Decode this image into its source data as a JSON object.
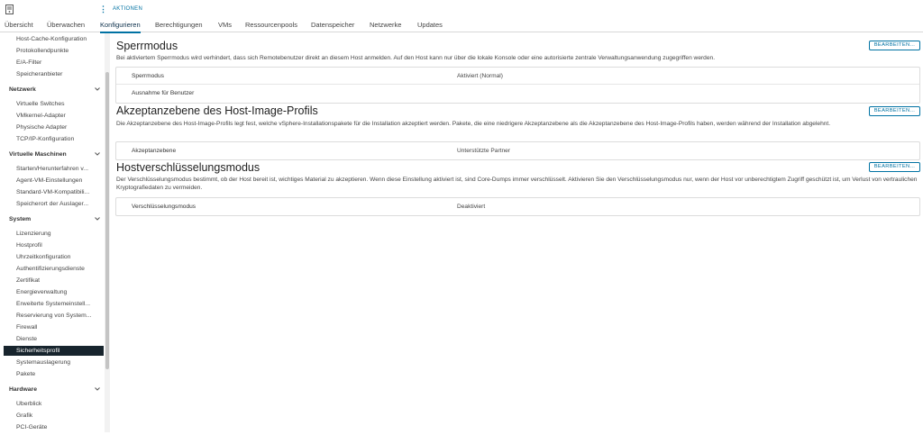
{
  "topbar": {
    "actions_label": "AKTIONEN",
    "host_icon": "host-server-icon",
    "actions_icon": "vertical-dots-icon"
  },
  "tabs": [
    {
      "label": "Übersicht"
    },
    {
      "label": "Überwachen"
    },
    {
      "label": "Konfigurieren",
      "active": true
    },
    {
      "label": "Berechtigungen"
    },
    {
      "label": "VMs"
    },
    {
      "label": "Ressourcenpools"
    },
    {
      "label": "Datenspeicher"
    },
    {
      "label": "Netzwerke"
    },
    {
      "label": "Updates"
    }
  ],
  "sidebar": {
    "top_items": [
      "Host-Cache-Konfiguration",
      "Protokollendpunkte",
      "E/A-Filter",
      "Speicheranbieter"
    ],
    "network": {
      "title": "Netzwerk",
      "items": [
        "Virtuelle Switches",
        "VMkernel-Adapter",
        "Physische Adapter",
        "TCP/IP-Konfiguration"
      ]
    },
    "vms": {
      "title": "Virtuelle Maschinen",
      "items": [
        "Starten/Herunterfahren v...",
        "Agent-VM-Einstellungen",
        "Standard-VM-Kompatibili...",
        "Speicherort der Auslager..."
      ]
    },
    "system": {
      "title": "System",
      "items": [
        "Lizenzierung",
        "Hostprofil",
        "Uhrzeitkonfiguration",
        "Authentifizierungsdienste",
        "Zertifikat",
        "Energieverwaltung",
        "Erweiterte Systemeinstell...",
        "Reservierung von System...",
        "Firewall",
        "Dienste",
        "Sicherheitsprofil",
        "Systemauslagerung",
        "Pakete"
      ],
      "selected": "Sicherheitsprofil"
    },
    "hardware": {
      "title": "Hardware",
      "items": [
        "Überblick",
        "Grafik",
        "PCI-Geräte"
      ]
    },
    "chevron_icon": "chevron-down-icon"
  },
  "sections": {
    "lockdown": {
      "title": "Sperrmodus",
      "description": "Bei aktiviertem Sperrmodus wird verhindert, dass sich Remotebenutzer direkt an diesem Host anmelden. Auf den Host kann nur über die lokale Konsole oder eine autorisierte zentrale Verwaltungsanwendung zugegriffen werden.",
      "edit_label": "BEARBEITEN...",
      "rows": [
        {
          "key": "Sperrmodus",
          "value": "Aktiviert (Normal)"
        },
        {
          "key": "Ausnahme für Benutzer",
          "value": ""
        }
      ]
    },
    "acceptance": {
      "title": "Akzeptanzebene des Host-Image-Profils",
      "description": "Die Akzeptanzebene des Host-Image-Profils legt fest, welche vSphere-Installationspakete für die Installation akzeptiert werden. Pakete, die eine niedrigere Akzeptanzebene als die Akzeptanzebene des Host-Image-Profils haben, werden während der Installation abgelehnt.",
      "edit_label": "BEARBEITEN...",
      "rows": [
        {
          "key": "Akzeptanzebene",
          "value": "Unterstützte Partner"
        }
      ]
    },
    "encryption": {
      "title": "Hostverschlüsselungsmodus",
      "description": "Der Verschlüsselungsmodus bestimmt, ob der Host bereit ist, wichtiges Material zu akzeptieren. Wenn diese Einstellung aktiviert ist, sind Core-Dumps immer verschlüsselt. Aktivieren Sie den Verschlüsselungsmodus nur, wenn der Host vor unberechtigtem Zugriff geschützt ist, um Verlust von vertraulichen Kryptografiedaten zu vermeiden.",
      "edit_label": "BEARBEITEN...",
      "rows": [
        {
          "key": "Verschlüsselungsmodus",
          "value": "Deaktiviert"
        }
      ]
    }
  },
  "colors": {
    "accent": "#0072a3",
    "selected_bg": "#17242d"
  }
}
